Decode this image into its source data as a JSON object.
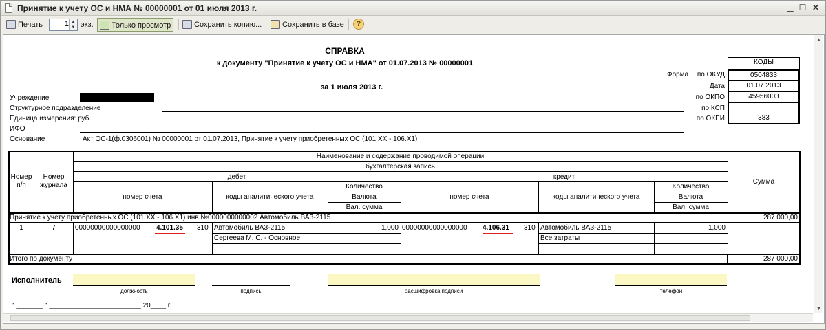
{
  "window": {
    "title": "Принятие к учету ОС и НМА № 00000001 от 01 июля 2013 г."
  },
  "toolbar": {
    "print": "Печать",
    "copies": "1",
    "copies_suffix": "экз.",
    "view_only": "Только просмотр",
    "save_copy": "Сохранить копию...",
    "save_db": "Сохранить в базе",
    "help": "?"
  },
  "header": {
    "title": "СПРАВКА",
    "subtitle": "к документу \"Принятие к учету ОС и НМА\" от 01.07.2013 № 00000001",
    "date_line": "за 1 июля 2013 г."
  },
  "codes": {
    "header": "КОДЫ",
    "form_label": "Форма",
    "okud_label": "по ОКУД",
    "okud": "0504833",
    "date_label": "Дата",
    "date": "01.07.2013",
    "okpo_label": "по ОКПО",
    "okpo": "45956003",
    "ksp_label": "по КСП",
    "ksp": "",
    "okei_label": "по ОКЕИ",
    "okei": "383"
  },
  "fields": {
    "institution": "Учреждение",
    "department": "Структурное подразделение",
    "unit": "Единица измерения: руб.",
    "ifo": "ИФО",
    "basis_label": "Основание",
    "basis": "Акт ОС-1(ф.0306001) № 00000001 от 01.07.2013, Принятие к учету приобретенных ОС (101.ХХ - 106.Х1)"
  },
  "table": {
    "col_num": "Номер п/п",
    "col_journal": "Номер журнала",
    "col_name": "Наименование и содержание проводимой операции",
    "col_entry": "бухгалтерская запись",
    "col_debit": "дебет",
    "col_credit": "кредит",
    "col_account": "номер счета",
    "col_analytic": "коды аналитического учета",
    "col_qty": "Количество",
    "col_currency": "Валюта",
    "col_curr_sum": "Вал. сумма",
    "col_sum": "Сумма",
    "op_title": "Принятие к учету приобретенных ОС (101.ХХ - 106.Х1) инв.№0000000000002 Автомобиль ВАЗ-2115",
    "op_sum": "287 000,00",
    "row": {
      "num": "1",
      "journal": "7",
      "debit_acc_prefix": "00000000000000000",
      "debit_acc": "4.101.35",
      "debit_code": "310",
      "debit_an1": "Автомобиль ВАЗ-2115",
      "debit_an2": "Сергеева М. С. - Основное",
      "debit_qty": "1,000",
      "credit_acc_prefix": "00000000000000000",
      "credit_acc": "4.106.31",
      "credit_code": "310",
      "credit_an1": "Автомобиль ВАЗ-2115",
      "credit_an2": "Все затраты",
      "credit_qty": "1,000"
    },
    "total_label": "Итого по документу",
    "total": "287 000,00"
  },
  "footer": {
    "executor": "Исполнитель",
    "position": "должность",
    "signature": "подпись",
    "decode": "расшифровка подписи",
    "phone": "телефон",
    "date_line": "\" _______ \" ________________________ 20____ г."
  },
  "colors": {
    "highlight_yellow": "#fcf8c4",
    "underline_red": "#e0201c"
  }
}
